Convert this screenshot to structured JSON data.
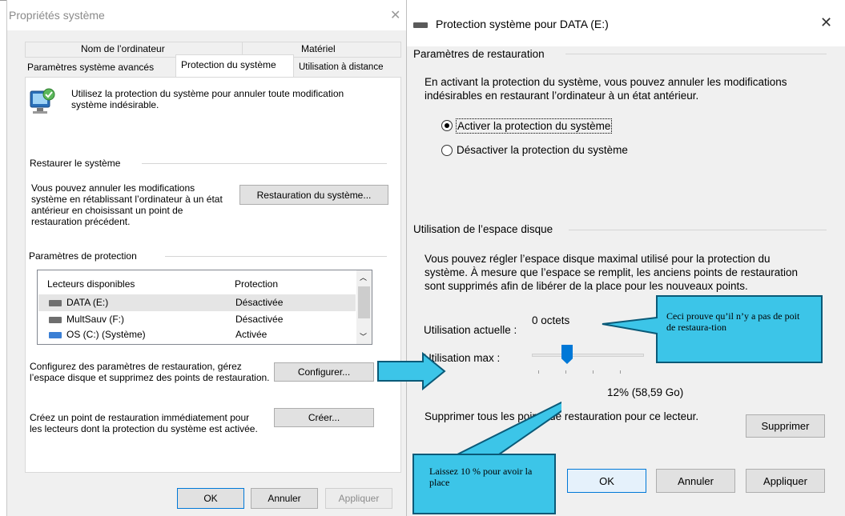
{
  "left": {
    "title": "Propriétés système",
    "close_glyph": "✕",
    "tabs_row1": [
      "Nom de l’ordinateur",
      "Matériel"
    ],
    "tabs_row2": [
      "Paramètres système avancés",
      "Protection du système",
      "Utilisation à distance"
    ],
    "intro": "Utilisez la protection du système pour annuler toute modification système indésirable.",
    "restore_group": "Restaurer le système",
    "restore_text": "Vous pouvez annuler les modifications système en rétablissant l’ordinateur à un état antérieur en choisissant un point de restauration précédent.",
    "restore_button": "Restauration du système...",
    "protection_group": "Paramètres de protection",
    "list_headers": [
      "Lecteurs disponibles",
      "Protection"
    ],
    "drives": [
      {
        "name": "DATA (E:)",
        "status": "Désactivée"
      },
      {
        "name": "MultSauv (F:)",
        "status": "Désactivée"
      },
      {
        "name": "OS (C:) (Système)",
        "status": "Activée"
      }
    ],
    "configure_text": "Configurez des paramètres de restauration, gérez l’espace disque et supprimez des points de restauration.",
    "configure_button": "Configurer...",
    "create_text": "Créez un point de restauration immédiatement pour les lecteurs dont la protection du système est activée.",
    "create_button": "Créer...",
    "ok": "OK",
    "cancel": "Annuler",
    "apply": "Appliquer"
  },
  "right": {
    "title": "Protection système pour DATA (E:)",
    "close_glyph": "✕",
    "restore_settings_group": "Paramètres de restauration",
    "restore_settings_text": "En activant la protection du système, vous pouvez annuler les modifications indésirables en restaurant l’ordinateur à un état antérieur.",
    "radio_enable": "Activer la protection du système",
    "radio_disable": "Désactiver la protection du système",
    "disk_group": "Utilisation de l’espace disque",
    "disk_text": "Vous pouvez régler l’espace disque maximal utilisé pour la protection du système. À mesure que l’espace se remplit, les anciens points de restauration sont supprimés afin de libérer de la place pour les nouveaux points.",
    "current_usage_label": "Utilisation actuelle :",
    "current_usage_value": "0 octets",
    "max_usage_label": "Utilisation max :",
    "max_usage_value": "12% (58,59 Go)",
    "max_usage_fraction": 0.12,
    "delete_text": "Supprimer tous les points de restauration pour ce lecteur.",
    "delete_button": "Supprimer",
    "ok": "OK",
    "cancel": "Annuler",
    "apply": "Appliquer"
  },
  "annotations": {
    "callout_right": "Ceci prouve qu’il n’y a pas  de poit de restaura-tion",
    "callout_left": "Laissez 10 % pour avoir la place",
    "callout_color": "#3cc5e8",
    "callout_border": "#0a5a78"
  }
}
